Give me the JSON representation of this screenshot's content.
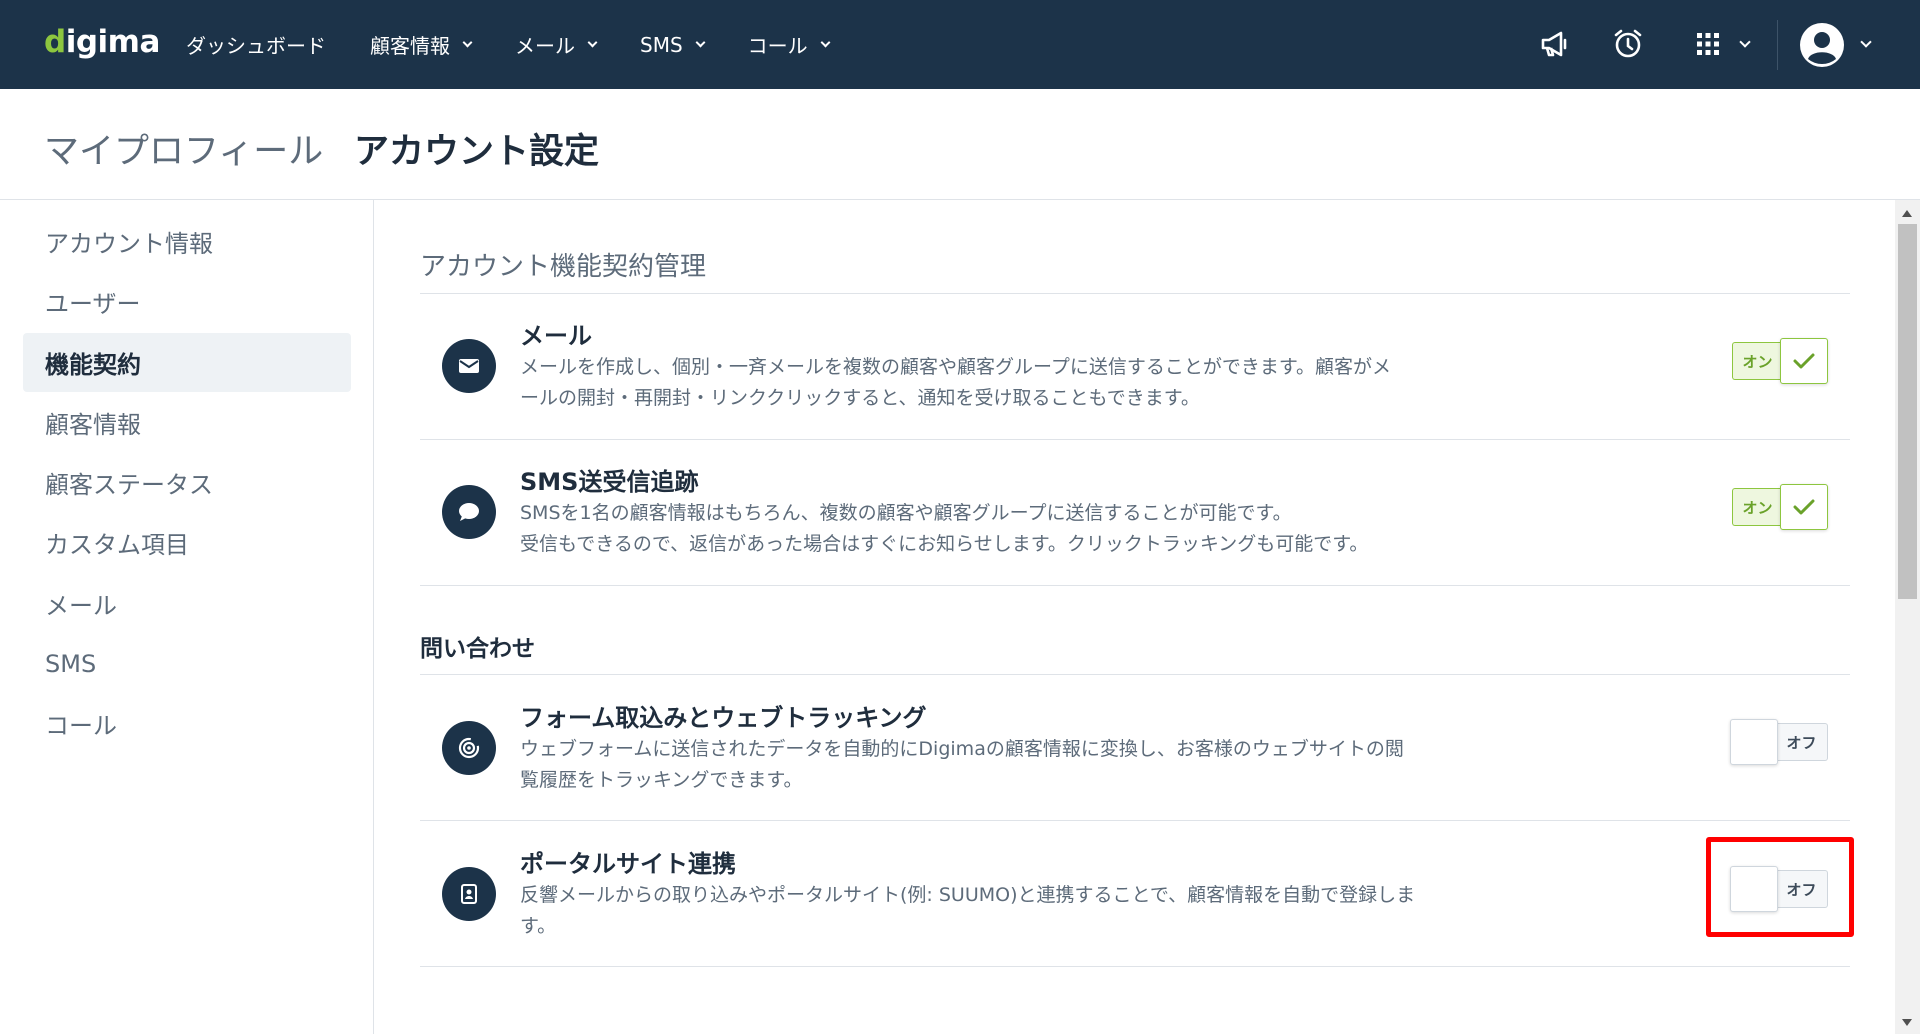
{
  "app": {
    "logo_prefix": "d",
    "logo_rest": "igima"
  },
  "nav": {
    "items": [
      {
        "label": "ダッシュボード",
        "has_dropdown": false
      },
      {
        "label": "顧客情報",
        "has_dropdown": true
      },
      {
        "label": "メール",
        "has_dropdown": true
      },
      {
        "label": "SMS",
        "has_dropdown": true
      },
      {
        "label": "コール",
        "has_dropdown": true
      }
    ],
    "icons": [
      "megaphone-icon",
      "alarm-clock-icon",
      "apps-grid-icon",
      "user-avatar-icon"
    ]
  },
  "header": {
    "crumb_parent": "マイプロフィール",
    "crumb_current": "アカウント設定"
  },
  "sidebar": {
    "items": [
      {
        "label": "アカウント情報",
        "active": false
      },
      {
        "label": "ユーザー",
        "active": false
      },
      {
        "label": "機能契約",
        "active": true
      },
      {
        "label": "顧客情報",
        "active": false
      },
      {
        "label": "顧客ステータス",
        "active": false
      },
      {
        "label": "カスタム項目",
        "active": false
      },
      {
        "label": "メール",
        "active": false
      },
      {
        "label": "SMS",
        "active": false
      },
      {
        "label": "コール",
        "active": false
      }
    ]
  },
  "main": {
    "section_title": "アカウント機能契約管理",
    "inquiry_heading": "問い合わせ",
    "features": [
      {
        "icon": "envelope-icon",
        "title": "メール",
        "desc_line1": "メールを作成し、個別・一斉メールを複数の顧客や顧客グループに送信することができます。顧客がメ",
        "desc_line2": "ールの開封・再開封・リンククリックすると、通知を受け取ることもできます。",
        "state": "on",
        "toggle_label": "オン"
      },
      {
        "icon": "chat-bubble-icon",
        "title": "SMS送受信追跡",
        "desc_line1": "SMSを1名の顧客情報はもちろん、複数の顧客や顧客グループに送信することが可能です。",
        "desc_line2": "受信もできるので、返信があった場合はすぐにお知らせします。クリックトラッキングも可能です。",
        "state": "on",
        "toggle_label": "オン"
      },
      {
        "icon": "web-tracking-icon",
        "title": "フォーム取込みとウェブトラッキング",
        "desc_line1": "ウェブフォームに送信されたデータを自動的にDigimaの顧客情報に変換し、お客様のウェブサイトの閲",
        "desc_line2": "覧履歴をトラッキングできます。",
        "state": "off",
        "toggle_label": "オフ"
      },
      {
        "icon": "document-person-icon",
        "title": "ポータルサイト連携",
        "desc_line1": "反響メールからの取り込みやポータルサイト(例: SUUMO)と連携することで、顧客情報を自動で登録しま",
        "desc_line2": "す。",
        "state": "off",
        "toggle_label": "オフ"
      }
    ]
  },
  "colors": {
    "nav_bg": "#1c3349",
    "brand_green": "#8dc63f",
    "highlight": "#ff0000"
  }
}
